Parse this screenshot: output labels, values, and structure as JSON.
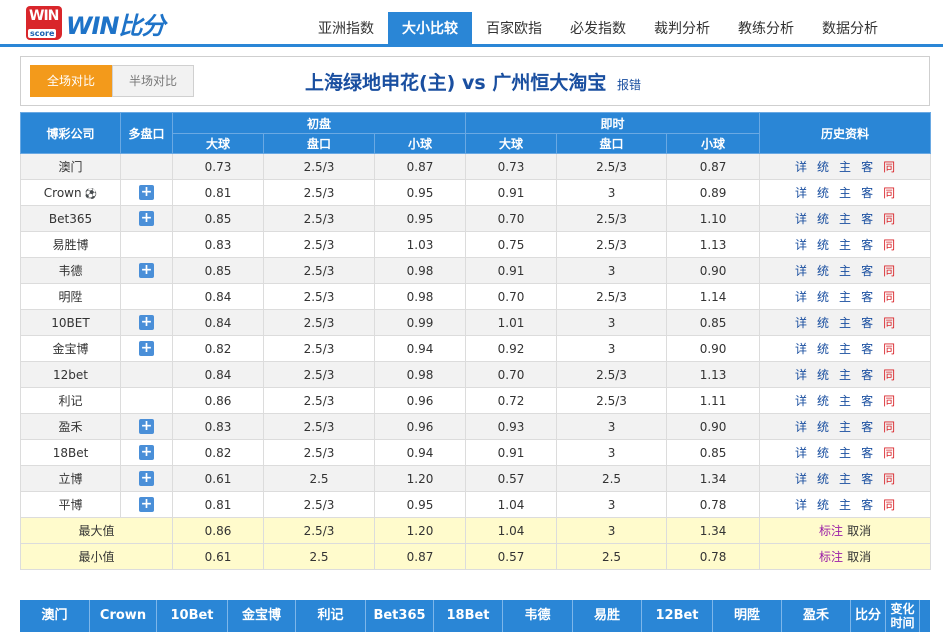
{
  "logo": {
    "win": "WIN",
    "score": "score",
    "text": "WIN比分"
  },
  "nav": [
    "亚洲指数",
    "大小比较",
    "百家欧指",
    "必发指数",
    "裁判分析",
    "教练分析",
    "数据分析"
  ],
  "toggle": {
    "full": "全场对比",
    "half": "半场对比"
  },
  "match": {
    "home": "上海绿地申花(主)",
    "vs": "vs",
    "away": "广州恒大淘宝",
    "report": "报错"
  },
  "headers": {
    "company": "博彩公司",
    "multi": "多盘口",
    "initial": "初盘",
    "live": "即时",
    "history": "历史资料",
    "big": "大球",
    "line": "盘口",
    "small": "小球"
  },
  "history_links": [
    "详",
    "统",
    "主",
    "客",
    "同"
  ],
  "rows": [
    {
      "name": "澳门",
      "plus": false,
      "ball": false,
      "i_big": "0.73",
      "i_line": "2.5/3",
      "i_small": "0.87",
      "l_big": "0.73",
      "l_line": "2.5/3",
      "l_small": "0.87"
    },
    {
      "name": "Crown",
      "plus": true,
      "ball": true,
      "i_big": "0.81",
      "i_line": "2.5/3",
      "i_small": "0.95",
      "l_big": "0.91",
      "l_line": "3",
      "l_small": "0.89"
    },
    {
      "name": "Bet365",
      "plus": true,
      "ball": false,
      "i_big": "0.85",
      "i_line": "2.5/3",
      "i_small": "0.95",
      "l_big": "0.70",
      "l_line": "2.5/3",
      "l_small": "1.10"
    },
    {
      "name": "易胜博",
      "plus": false,
      "ball": false,
      "i_big": "0.83",
      "i_line": "2.5/3",
      "i_small": "1.03",
      "l_big": "0.75",
      "l_line": "2.5/3",
      "l_small": "1.13"
    },
    {
      "name": "韦德",
      "plus": true,
      "ball": false,
      "i_big": "0.85",
      "i_line": "2.5/3",
      "i_small": "0.98",
      "l_big": "0.91",
      "l_line": "3",
      "l_small": "0.90"
    },
    {
      "name": "明陞",
      "plus": false,
      "ball": false,
      "i_big": "0.84",
      "i_line": "2.5/3",
      "i_small": "0.98",
      "l_big": "0.70",
      "l_line": "2.5/3",
      "l_small": "1.14"
    },
    {
      "name": "10BET",
      "plus": true,
      "ball": false,
      "i_big": "0.84",
      "i_line": "2.5/3",
      "i_small": "0.99",
      "l_big": "1.01",
      "l_line": "3",
      "l_small": "0.85"
    },
    {
      "name": "金宝博",
      "plus": true,
      "ball": false,
      "i_big": "0.82",
      "i_line": "2.5/3",
      "i_small": "0.94",
      "l_big": "0.92",
      "l_line": "3",
      "l_small": "0.90"
    },
    {
      "name": "12bet",
      "plus": false,
      "ball": false,
      "i_big": "0.84",
      "i_line": "2.5/3",
      "i_small": "0.98",
      "l_big": "0.70",
      "l_line": "2.5/3",
      "l_small": "1.13"
    },
    {
      "name": "利记",
      "plus": false,
      "ball": false,
      "i_big": "0.86",
      "i_line": "2.5/3",
      "i_small": "0.96",
      "l_big": "0.72",
      "l_line": "2.5/3",
      "l_small": "1.11"
    },
    {
      "name": "盈禾",
      "plus": true,
      "ball": false,
      "i_big": "0.83",
      "i_line": "2.5/3",
      "i_small": "0.96",
      "l_big": "0.93",
      "l_line": "3",
      "l_small": "0.90"
    },
    {
      "name": "18Bet",
      "plus": true,
      "ball": false,
      "i_big": "0.82",
      "i_line": "2.5/3",
      "i_small": "0.94",
      "l_big": "0.91",
      "l_line": "3",
      "l_small": "0.85"
    },
    {
      "name": "立博",
      "plus": true,
      "ball": false,
      "i_big": "0.61",
      "i_line": "2.5",
      "i_small": "1.20",
      "l_big": "0.57",
      "l_line": "2.5",
      "l_small": "1.34"
    },
    {
      "name": "平博",
      "plus": true,
      "ball": false,
      "i_big": "0.81",
      "i_line": "2.5/3",
      "i_small": "0.95",
      "l_big": "1.04",
      "l_line": "3",
      "l_small": "0.78"
    }
  ],
  "max_row": {
    "label": "最大值",
    "i_big": "0.86",
    "i_line": "2.5/3",
    "i_small": "1.20",
    "l_big": "1.04",
    "l_line": "3",
    "l_small": "1.34",
    "mark": "标注",
    "cancel": "取消"
  },
  "min_row": {
    "label": "最小值",
    "i_big": "0.61",
    "i_line": "2.5",
    "i_small": "0.87",
    "l_big": "0.57",
    "l_line": "2.5",
    "l_small": "0.78",
    "mark": "标注",
    "cancel": "取消"
  },
  "bottom_tabs": [
    "澳门",
    "Crown",
    "10Bet",
    "金宝博",
    "利记",
    "Bet365",
    "18Bet",
    "韦德",
    "易胜",
    "12Bet",
    "明陞",
    "盈禾",
    "比分",
    "变化时间"
  ],
  "colors": {
    "accent": "#2a86d6",
    "orange": "#f39a1b",
    "title": "#1a4fa0",
    "highlight": "#fffbcc",
    "red": "#d9262b"
  }
}
